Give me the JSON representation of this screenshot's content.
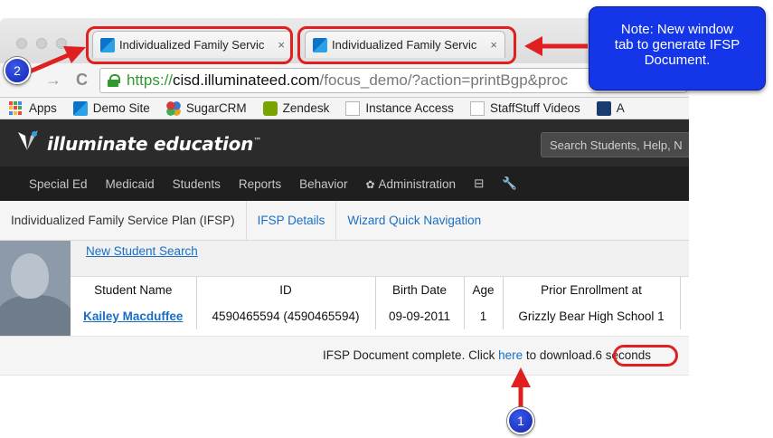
{
  "browser": {
    "tabs": [
      {
        "title": "Individualized Family Servic",
        "close": "×"
      },
      {
        "title": "Individualized Family Servic",
        "close": "×"
      }
    ],
    "nav": {
      "back": "←",
      "forward": "→",
      "reload": "C"
    },
    "url": {
      "scheme": "https://",
      "host": "cisd.illuminateed.com",
      "path": "/focus_demo/?action=printBgp&proc"
    },
    "bookmarks": [
      "Apps",
      "Demo Site",
      "SugarCRM",
      "Zendesk",
      "Instance Access",
      "StaffStuff Videos",
      "A"
    ]
  },
  "site": {
    "logo": "illuminate education",
    "logo_mark": "™",
    "search_placeholder": "Search Students, Help, N",
    "main_nav": [
      "Special Ed",
      "Medicaid",
      "Students",
      "Reports",
      "Behavior",
      "Administration"
    ],
    "sub_nav": {
      "title": "Individualized Family Service Plan (IFSP)",
      "links": [
        "IFSP Details",
        "Wizard Quick Navigation"
      ]
    },
    "new_search": "New Student Search",
    "student_table": {
      "headers": [
        "Student Name",
        "ID",
        "Birth Date",
        "Age",
        "Prior Enrollment at"
      ],
      "row": [
        "Kailey Macduffee",
        "4590465594 (4590465594)",
        "09-09-2011",
        "1",
        "Grizzly Bear High School 1"
      ]
    },
    "message": {
      "prefix": "IFSP Document complete. Click",
      "link": "here",
      "middle": "to download.",
      "countdown": "6 seconds"
    }
  },
  "annotations": {
    "note": "Note:  New window\ntab to generate IFSP\nDocument.",
    "badge_1": "1",
    "badge_2": "2",
    "accent_red": "#e02020",
    "accent_blue": "#1536e8"
  }
}
